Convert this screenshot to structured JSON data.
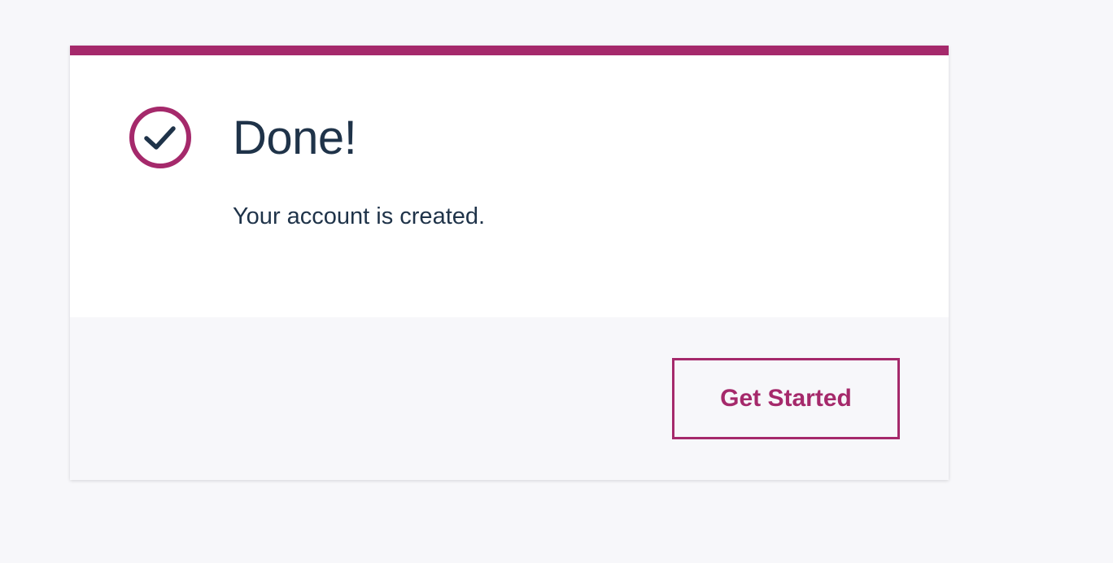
{
  "dialog": {
    "title": "Done!",
    "message": "Your account is created.",
    "status_icon": "check-circle-icon",
    "primary_button_label": "Get Started"
  },
  "colors": {
    "accent": "#a5296b",
    "text": "#1f3349",
    "background": "#f7f7fa",
    "card": "#ffffff"
  }
}
